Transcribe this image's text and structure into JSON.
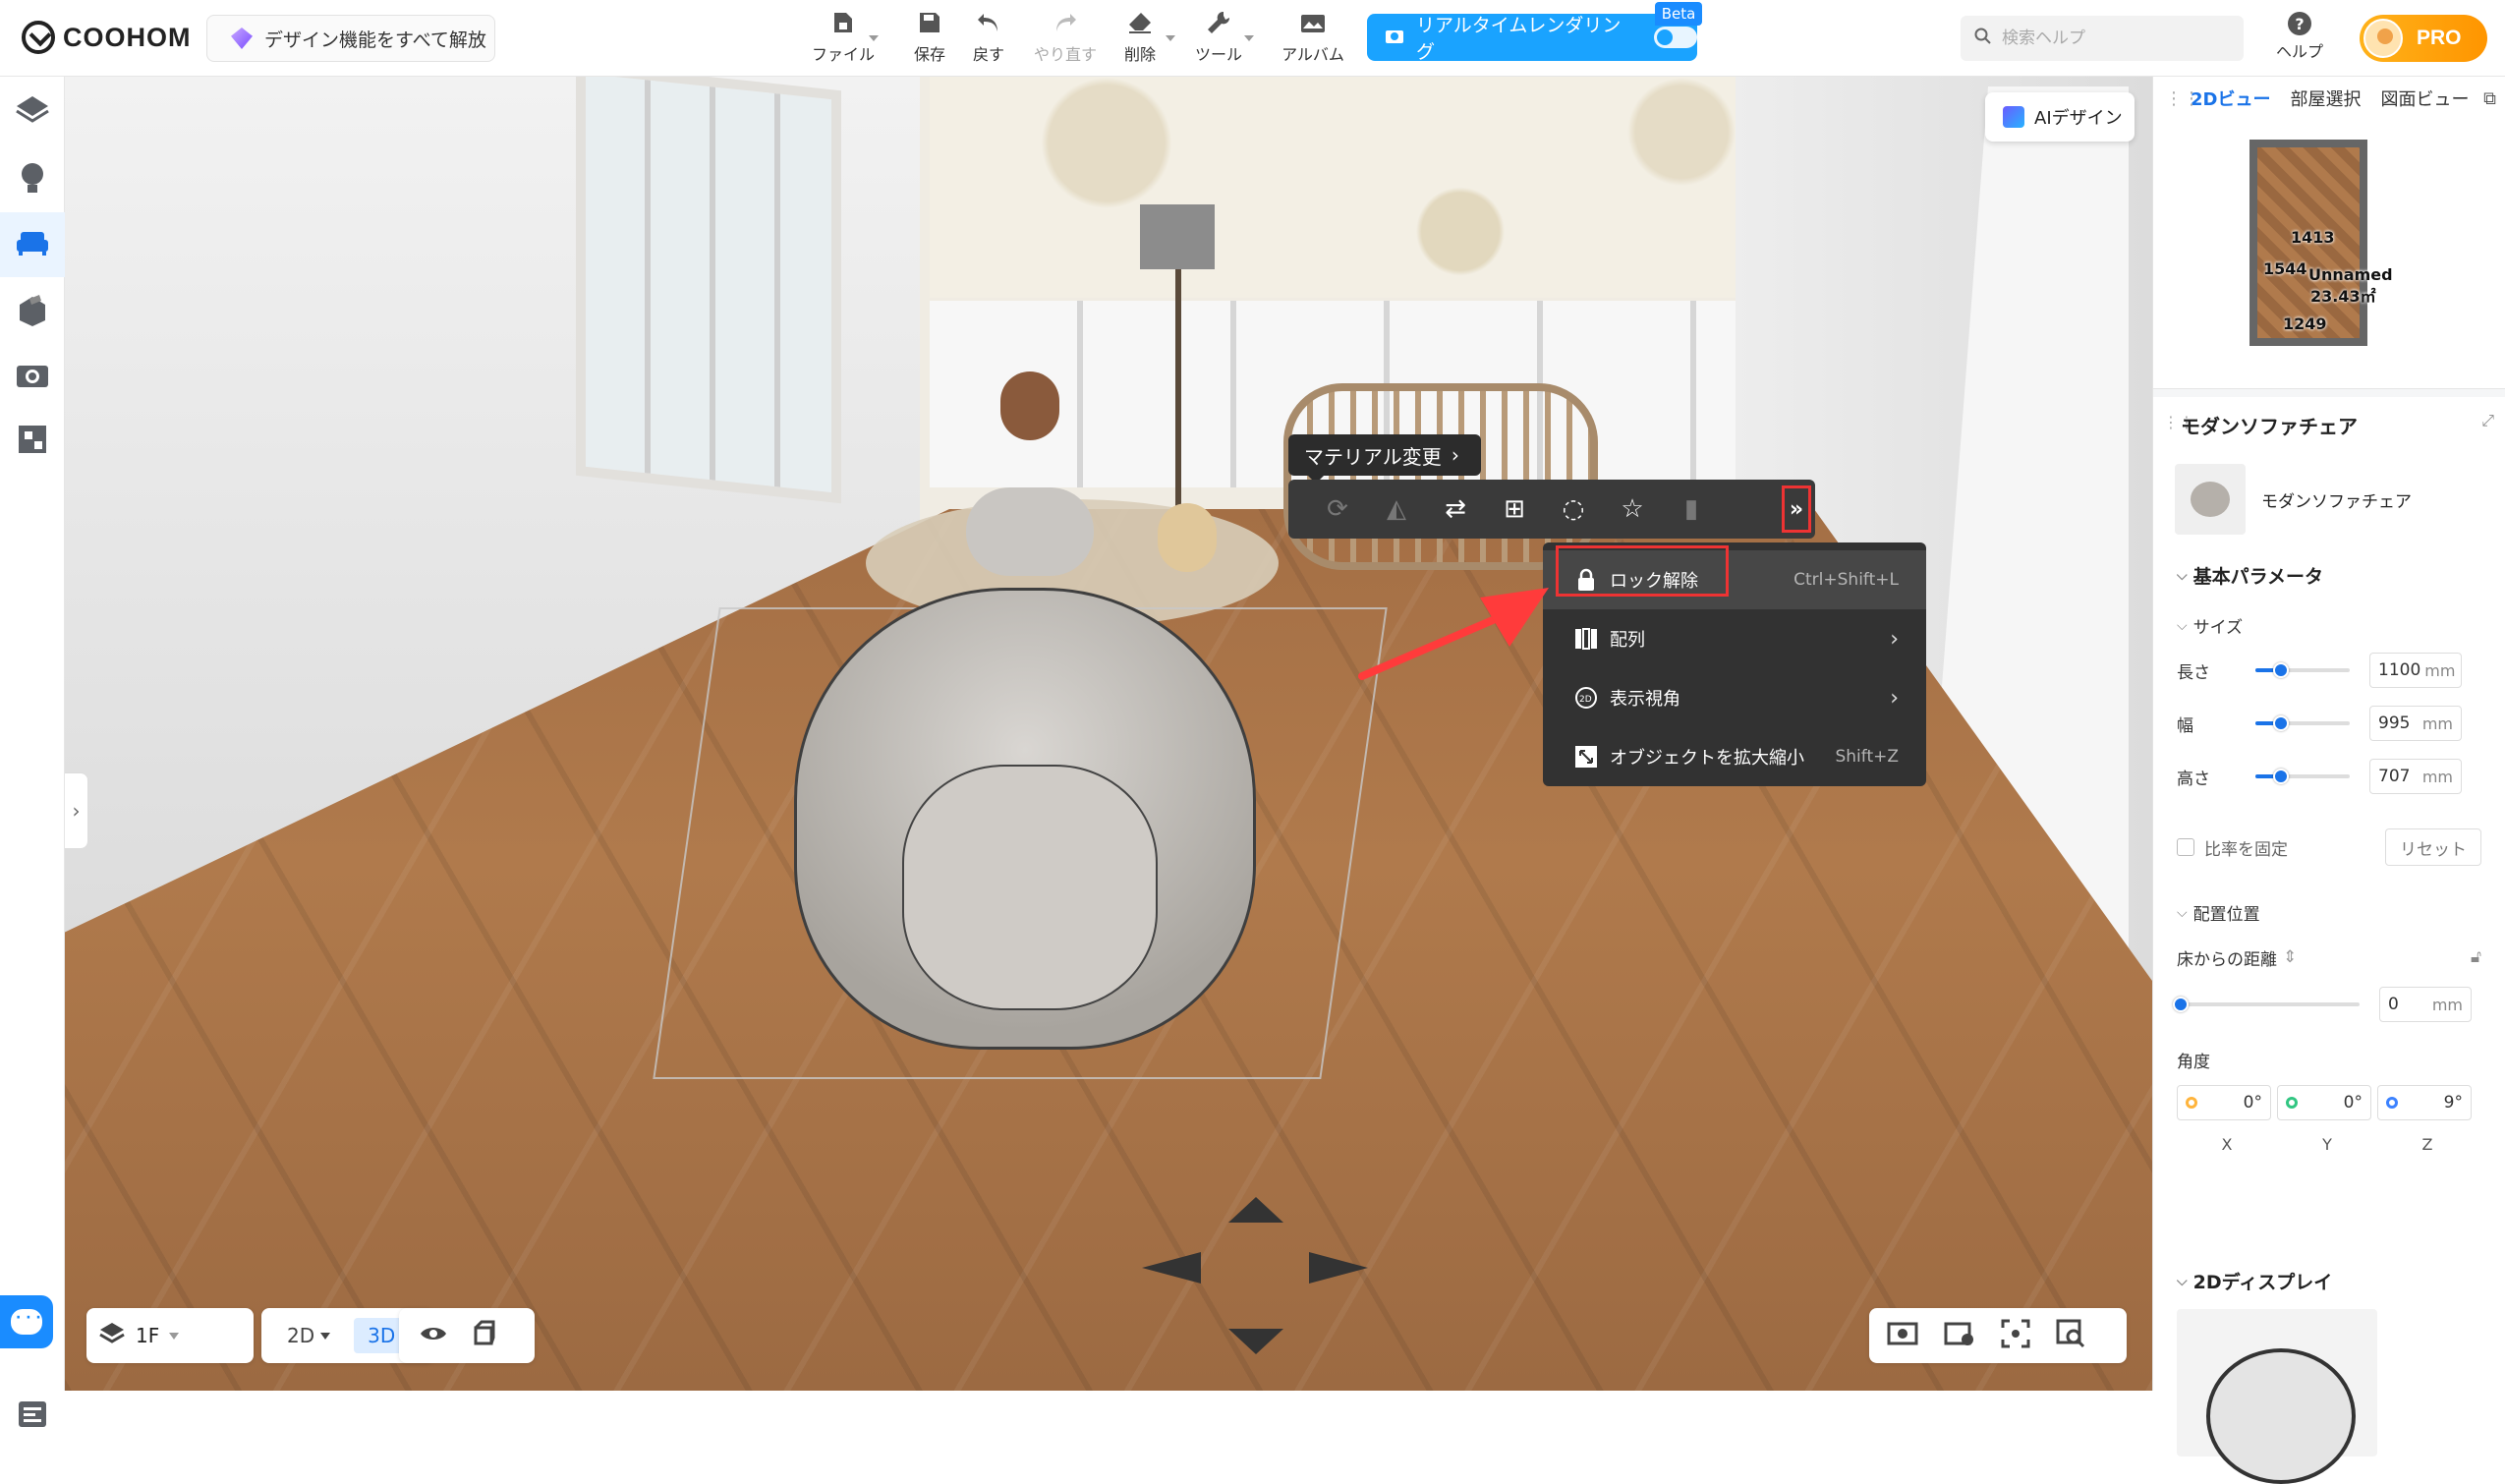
{
  "app": {
    "logo_text": "COOHOM",
    "unlock_label": "デザイン機能をすべて解放"
  },
  "toolbar": {
    "file": "ファイル",
    "save": "保存",
    "undo": "戻す",
    "redo": "やり直す",
    "delete": "削除",
    "tools": "ツール",
    "album": "アルバム",
    "render": "リアルタイムレンダリング",
    "beta": "Beta",
    "search_placeholder": "検索ヘルプ",
    "help": "ヘルプ",
    "pro": "PRO"
  },
  "canvas": {
    "ai_label": "AIデザイン",
    "material_tip": "マテリアル変更",
    "more_label": "»",
    "context_menu": [
      {
        "label": "ロック解除",
        "shortcut": "Ctrl+Shift+L",
        "icon": "lock-icon"
      },
      {
        "label": "配列",
        "shortcut": "",
        "icon": "array-icon",
        "submenu": true
      },
      {
        "label": "表示視角",
        "shortcut": "",
        "icon": "view-angle-icon",
        "submenu": true
      },
      {
        "label": "オブジェクトを拡大縮小",
        "shortcut": "Shift+Z",
        "icon": "scale-icon"
      }
    ],
    "floor_label": "1F",
    "view_2d": "2D",
    "view_3d": "3D"
  },
  "right_panel": {
    "tabs": [
      "2Dビュー",
      "部屋選択",
      "図面ビュー"
    ],
    "minimap_labels": [
      "1413",
      "1544",
      "Unnamed",
      "23.43㎡",
      "1249"
    ],
    "object_title": "モダンソファチェア",
    "product_name": "モダンソファチェア",
    "basic_params": "基本パラメータ",
    "size": "サイズ",
    "length_label": "長さ",
    "length_value": "1100",
    "width_label": "幅",
    "width_value": "995",
    "height_label": "高さ",
    "height_value": "707",
    "unit": "mm",
    "ratio_lock": "比率を固定",
    "reset": "リセット",
    "placement": "配置位置",
    "floor_distance": "床からの距離",
    "floor_distance_value": "0",
    "angle": "角度",
    "angle_x": "0",
    "angle_y": "0",
    "angle_z": "9",
    "deg": "°",
    "x": "X",
    "y": "Y",
    "z": "Z",
    "display_2d": "2Dディスプレイ"
  },
  "colors": {
    "accent": "#1a73e8",
    "render_button": "#1aa3ff",
    "highlight_red": "#e33333",
    "pro": "#ff9f0a"
  }
}
